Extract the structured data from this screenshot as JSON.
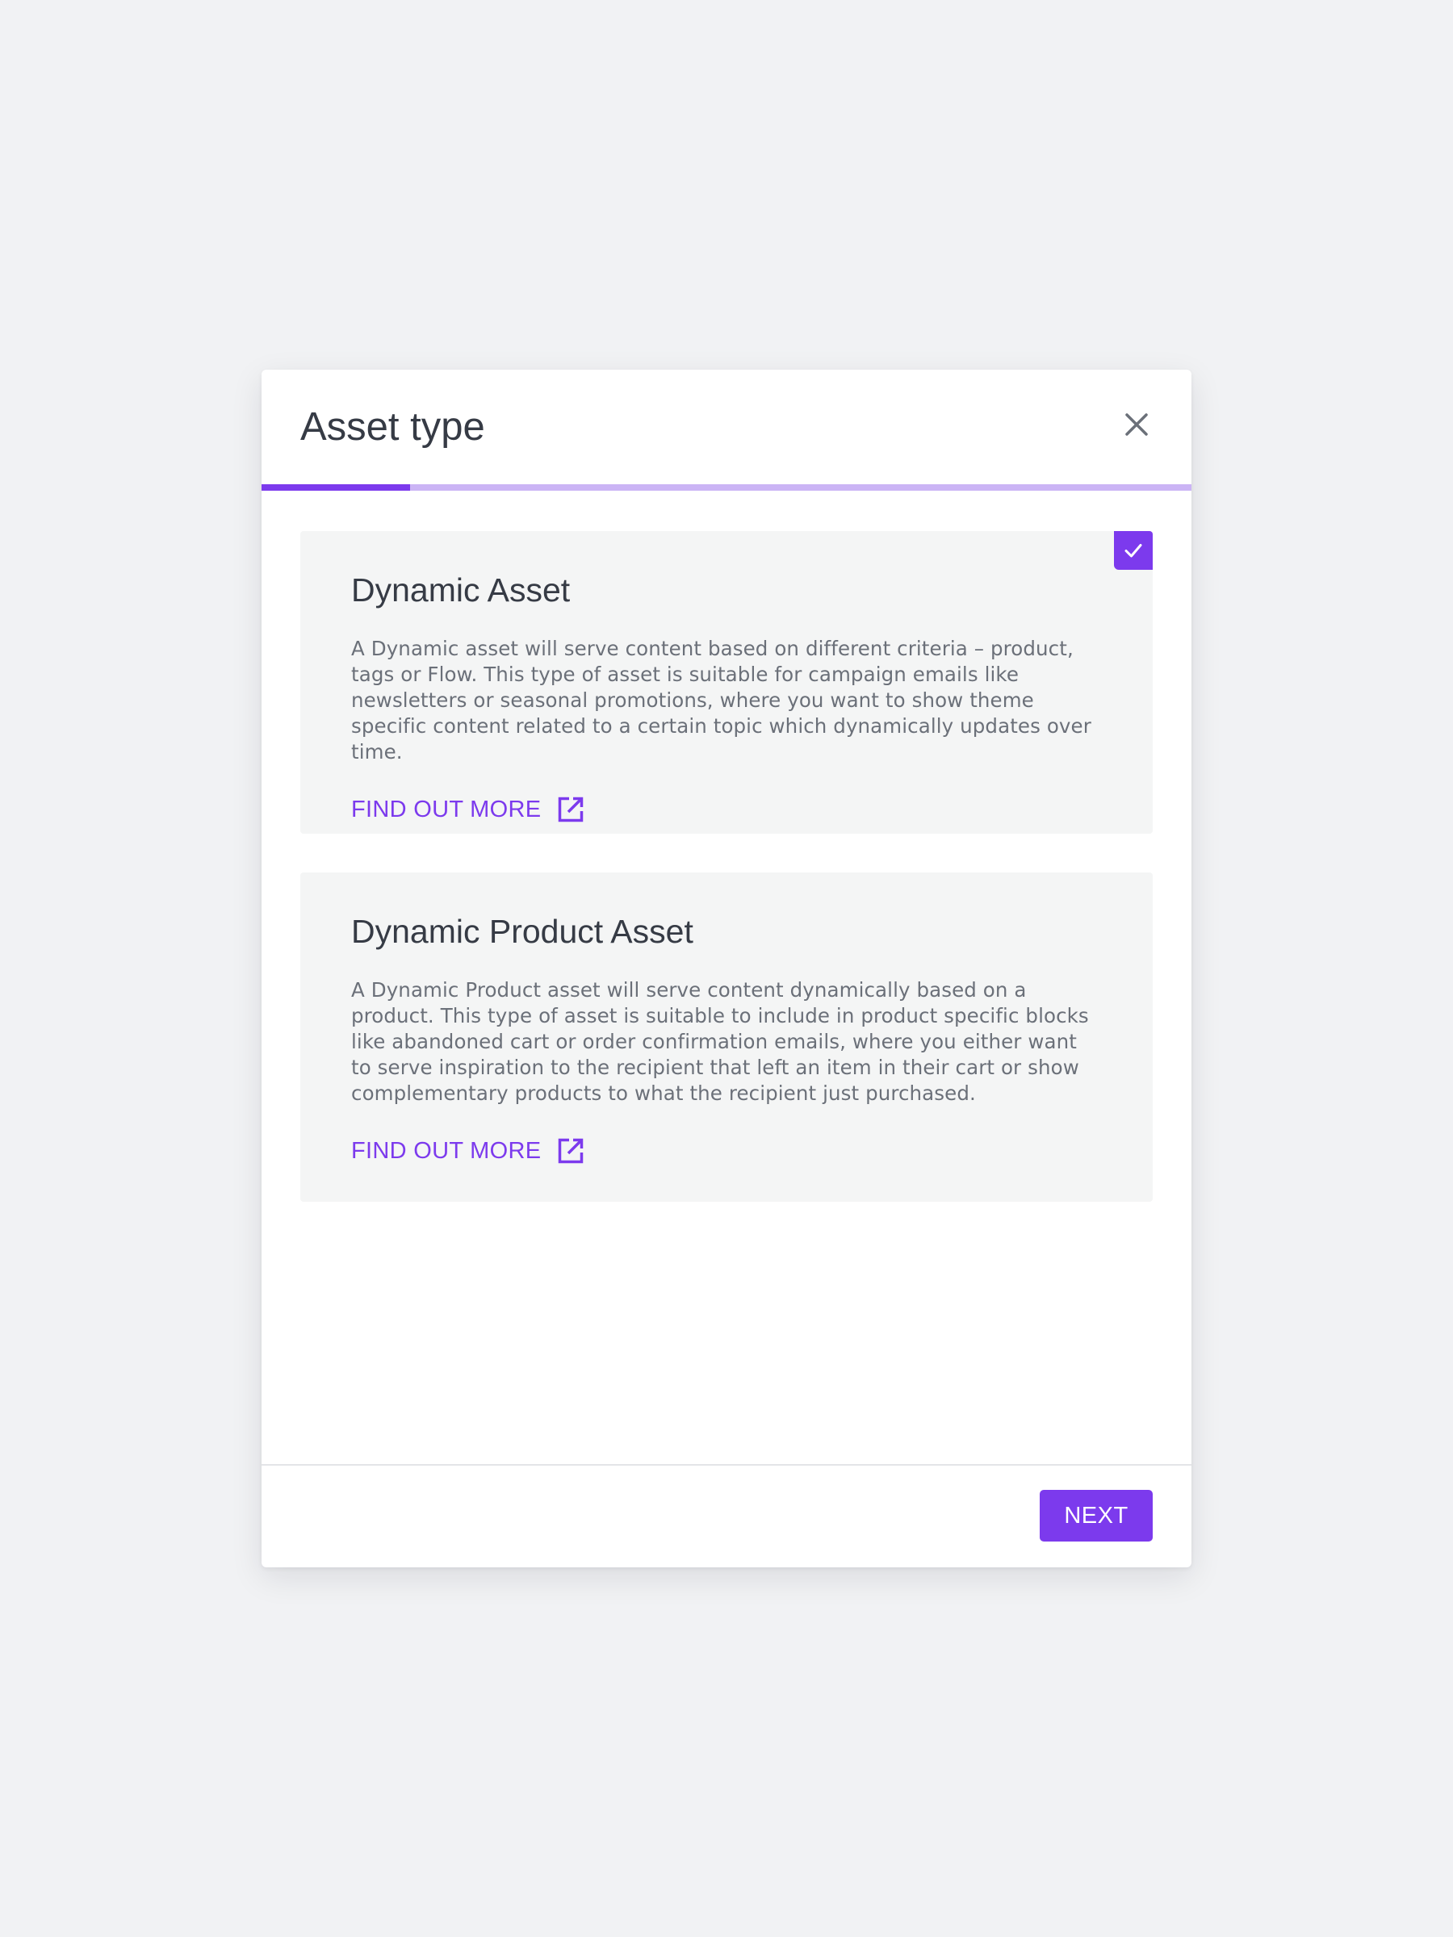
{
  "modal": {
    "title": "Asset type",
    "close_icon": "close-icon",
    "progress": 0.16
  },
  "options": [
    {
      "title": "Dynamic Asset",
      "description": "A Dynamic asset will serve content based on different criteria – product, tags or Flow. This type of asset is suitable for campaign emails like newsletters or seasonal promotions, where you want to show theme specific content related to a certain topic which dynamically updates over time.",
      "link_label": "FIND OUT MORE",
      "link_icon": "external-link-icon",
      "selected": true
    },
    {
      "title": "Dynamic Product Asset",
      "description": "A Dynamic Product asset will serve content dynamically based on a product. This type of asset is suitable to include in product specific blocks like abandoned cart or order confirmation emails, where you either want to serve inspiration to the recipient that left an item in their cart or show complementary products to what the recipient just purchased.",
      "link_label": "FIND OUT MORE",
      "link_icon": "external-link-icon",
      "selected": false
    }
  ],
  "footer": {
    "next_label": "NEXT"
  },
  "colors": {
    "accent": "#7c3aed",
    "accent_light": "#cbb4f5",
    "background": "#f1f2f4",
    "card_background": "#f4f5f5",
    "title_text": "#363b45",
    "body_text": "#6b7079"
  }
}
